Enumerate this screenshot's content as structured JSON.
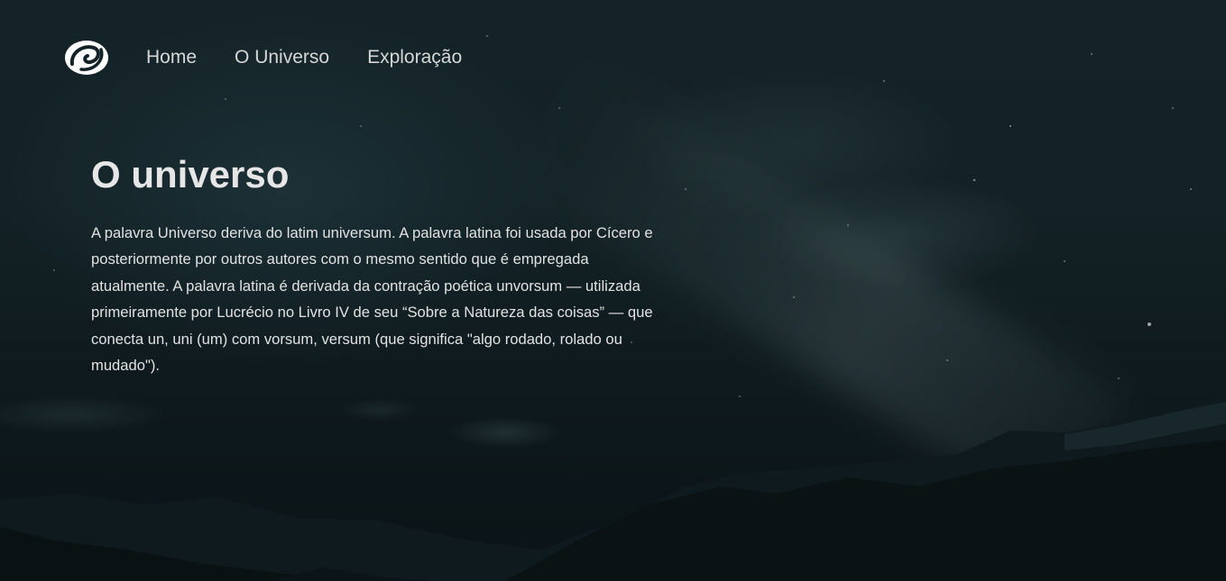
{
  "nav": {
    "logo_icon": "swirl-galaxy-icon",
    "items": [
      {
        "label": "Home"
      },
      {
        "label": "O Universo"
      },
      {
        "label": "Exploração"
      }
    ]
  },
  "main": {
    "title": "O universo",
    "paragraph": "A palavra Universo deriva do latim universum. A palavra latina foi usada por Cícero e posteriormente por outros autores com o mesmo sentido que é empregada atualmente. A palavra latina é derivada da contração poética unvorsum — utilizada primeiramente por Lucrécio no Livro IV de seu “Sobre a Natureza das coisas” — que conecta un, uni (um) com vorsum, versum (que significa \"algo rodado, rolado ou mudado\")."
  },
  "colors": {
    "background": "#132226",
    "text": "#e2e2e2",
    "nav_text": "#d6d6d6"
  }
}
